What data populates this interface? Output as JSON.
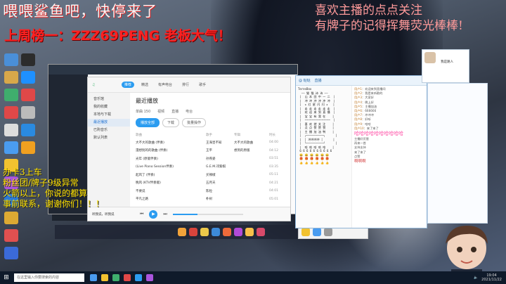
{
  "overlay": {
    "top_text_1": "喂喂鲨鱼吧，快停来了",
    "top_text_2": "上周榜一：ZZZ69PENG 老板大气！",
    "right_text_1": "喜欢主播的点点关注",
    "right_text_2": "有牌子的记得挥舞荧光棒棒!",
    "left_lines": [
      "办卡3上车",
      "粉丝团/牌子9级异常",
      "火箭以上，你说的都算",
      "事前联系，谢谢你们！！！"
    ]
  },
  "music_app": {
    "title": "最近播放",
    "tabs": [
      "单曲 150",
      "视频",
      "直播",
      "电台"
    ],
    "buttons": [
      "播放全部",
      "下载",
      "批量操作"
    ],
    "columns": [
      "歌曲",
      "歌手",
      "专辑",
      "时长"
    ],
    "nav": [
      "推荐",
      "精选",
      "有声电台",
      "排行",
      "歌手",
      "音乐馆",
      "我的收藏",
      "本地与下载",
      "最近播放",
      "已购音乐",
      "默认列表"
    ],
    "rows": [
      {
        "song": "大不大的歌曲 (伴奏)",
        "artist": "王海皇不知",
        "album": "大不大的歌曲",
        "time": "04:00"
      },
      {
        "song": "漫想别的的歌曲 (伴奏)",
        "artist": "王平",
        "album": "想到的原版",
        "time": "04:12"
      },
      {
        "song": "光年 (原版伴奏)",
        "artist": "孙燕姿",
        "album": "",
        "time": "03:51"
      },
      {
        "song": "(Live Piano Session伴奏)",
        "artist": "G.E.M.邓紫棋",
        "album": "",
        "time": "03:35"
      },
      {
        "song": "起风了 (伴奏)",
        "artist": "买辣椒",
        "album": "",
        "time": "05:11"
      },
      {
        "song": "晚风 (KTV伴奏版)",
        "artist": "五月天",
        "album": "",
        "time": "04:21"
      },
      {
        "song": "不要说",
        "artist": "陈粒",
        "album": "",
        "time": "04:01"
      },
      {
        "song": "平凡之路",
        "artist": "朴树",
        "album": "",
        "time": "05:01"
      }
    ],
    "player": {
      "song": "听我说，听我说",
      "progress": 0.35
    }
  },
  "chat": {
    "header": [
      "@ 哒哒",
      "直播"
    ],
    "art": "TeresBox\n  —— 猫 猫 诗 诗 ——\n |  山 本 田 中 一 二  |\n |  冲 冲 冲 冲 冲 冲  |\n |  ★ 红 星 闪 闪 ★   |\n |  走 走 走 走 走 走  |\n |  欢 迎 来 到 直 播  |\n |  宝 宝 有 我 在    |\n |  ~~~~~~~~~~~~~~~  |\n |  喜 欢 就 关 注    |\n |  点 点 赞 赞 赞    |\n |  主 播 加 油 鸭    |\n |  ┌──────────┐      |\n |  │ 冲冲冲冲 │      |\n |  └──────────┘      |\n |  哈 哈 哈 哈 哈    |\n 6 6 6 6 6 6 6 6 6 6\n 😀 😀 😀 😀 😀 😀\n 🎁 🎁 🎁 🎁 🎁 🎁\n 👍 👍 👍 👍 👍 👍",
    "messages": [
      {
        "name": "用户1",
        "text": "欢迎来到直播间"
      },
      {
        "name": "用户2",
        "text": "我是来听歌的"
      },
      {
        "name": "用户3",
        "text": "大家好"
      },
      {
        "name": "用户4",
        "text": "晚上好"
      },
      {
        "name": "用户5",
        "text": "主播加油"
      },
      {
        "name": "用户6",
        "text": "666666"
      },
      {
        "name": "用户7",
        "text": "冲冲冲"
      },
      {
        "name": "用户8",
        "text": "好听"
      },
      {
        "name": "用户9",
        "text": "哈哈"
      },
      {
        "name": "用户10",
        "text": "来了来了"
      }
    ],
    "big_msg": "哈哈哈哈哈哈哈哈哈哈",
    "tail": [
      "主播好厉害",
      "再来一首",
      "支持支持",
      "来了来了",
      "点赞"
    ],
    "end_msg": "啊啊啊"
  },
  "profile": {
    "name": "我是路人"
  },
  "taskbar": {
    "search": "在这里输入你要搜索的内容",
    "time": "19:04",
    "date": "2021/11/22"
  },
  "colors": {
    "accent": "#2b9cf0",
    "red": "#ff2020",
    "yellow": "#ffe200",
    "pink": "#ff9a9a"
  }
}
